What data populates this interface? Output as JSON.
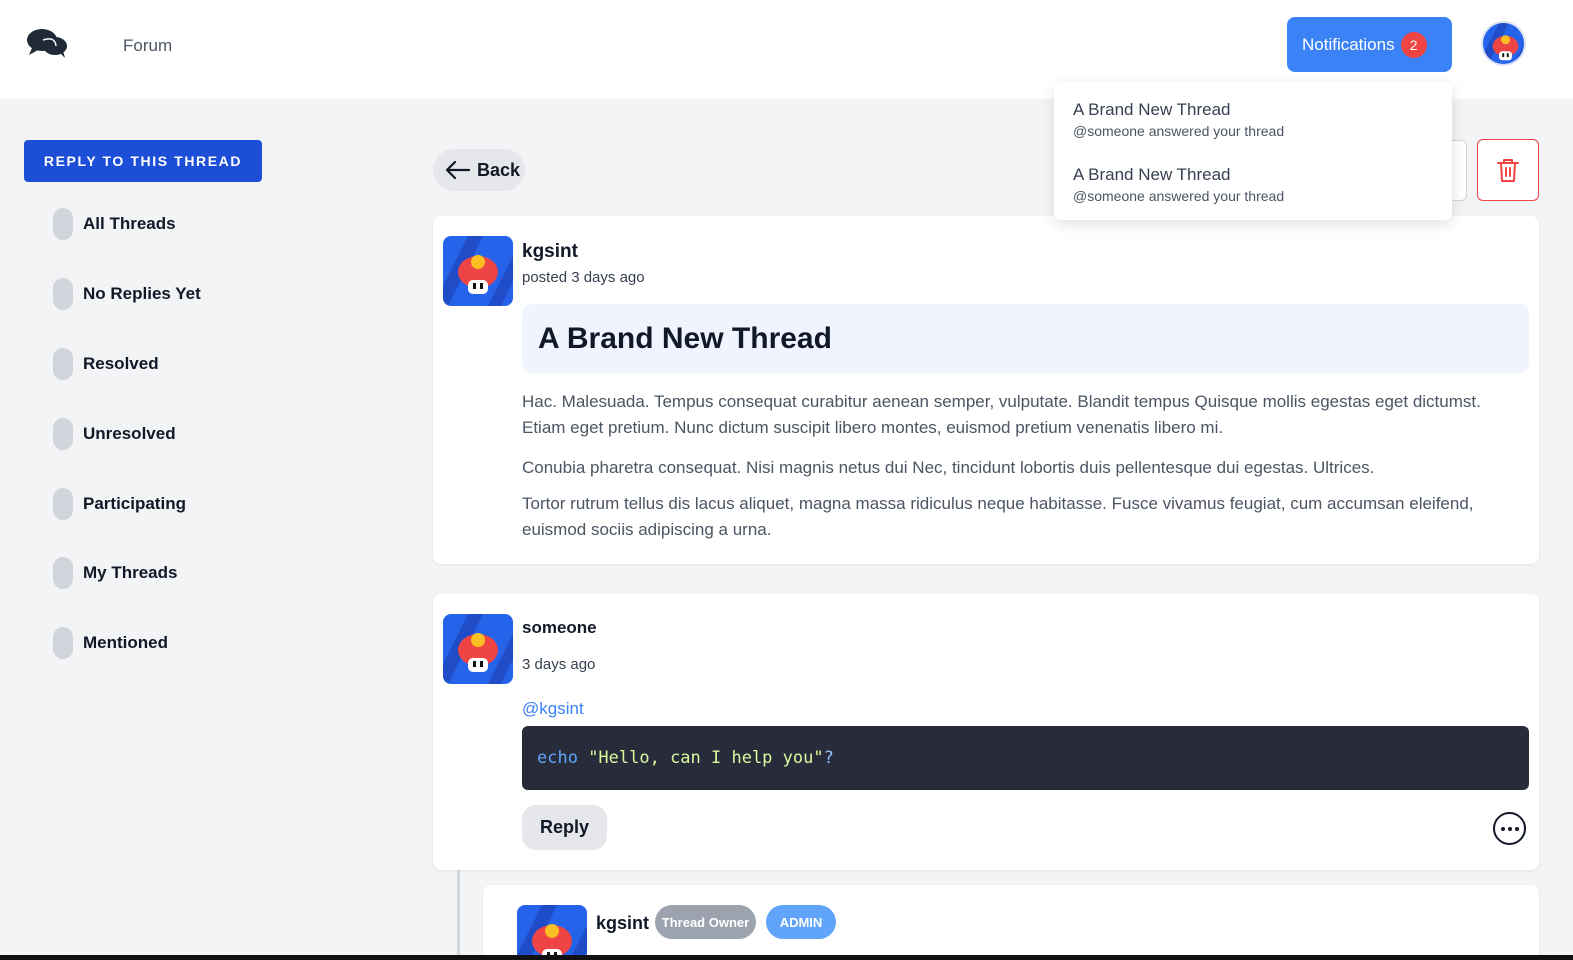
{
  "header": {
    "nav_label": "Forum",
    "notifications_label": "Notifications",
    "notifications_count": "2"
  },
  "notifications": [
    {
      "title": "A Brand New Thread",
      "subtitle": "@someone answered your thread"
    },
    {
      "title": "A Brand New Thread",
      "subtitle": "@someone answered your thread"
    }
  ],
  "sidebar": {
    "reply_button": "REPLY TO THIS THREAD",
    "items": [
      {
        "label": "All Threads"
      },
      {
        "label": "No Replies Yet"
      },
      {
        "label": "Resolved"
      },
      {
        "label": "Unresolved"
      },
      {
        "label": "Participating"
      },
      {
        "label": "My Threads"
      },
      {
        "label": "Mentioned"
      }
    ]
  },
  "toolbar": {
    "back_label": "Back"
  },
  "thread": {
    "author": "kgsint",
    "posted": "posted 3 days ago",
    "title": "A Brand New Thread",
    "paragraphs": [
      "Hac. Malesuada. Tempus consequat curabitur aenean semper, vulputate. Blandit tempus Quisque mollis egestas eget dictumst. Etiam eget pretium. Nunc dictum suscipit libero montes, euismod pretium venenatis libero mi.",
      "Conubia pharetra consequat. Nisi magnis netus dui Nec, tincidunt lobortis duis pellentesque dui egestas. Ultrices.",
      "Tortor rutrum tellus dis lacus aliquet, magna massa ridiculus neque habitasse. Fusce vivamus feugiat, cum accumsan eleifend, euismod sociis adipiscing a urna."
    ]
  },
  "reply": {
    "author": "someone",
    "time": "3 days ago",
    "mention": "@kgsint",
    "code_keyword": "echo",
    "code_string": " \"Hello, can I help you\"",
    "code_punct": "?",
    "reply_label": "Reply"
  },
  "nested_reply": {
    "author": "kgsint",
    "badge_owner": "Thread Owner",
    "badge_admin": "ADMIN"
  },
  "colors": {
    "accent": "#3b82f6",
    "primary_button": "#1d4ed8",
    "danger": "#ef4444",
    "code_bg": "#272b3a"
  }
}
